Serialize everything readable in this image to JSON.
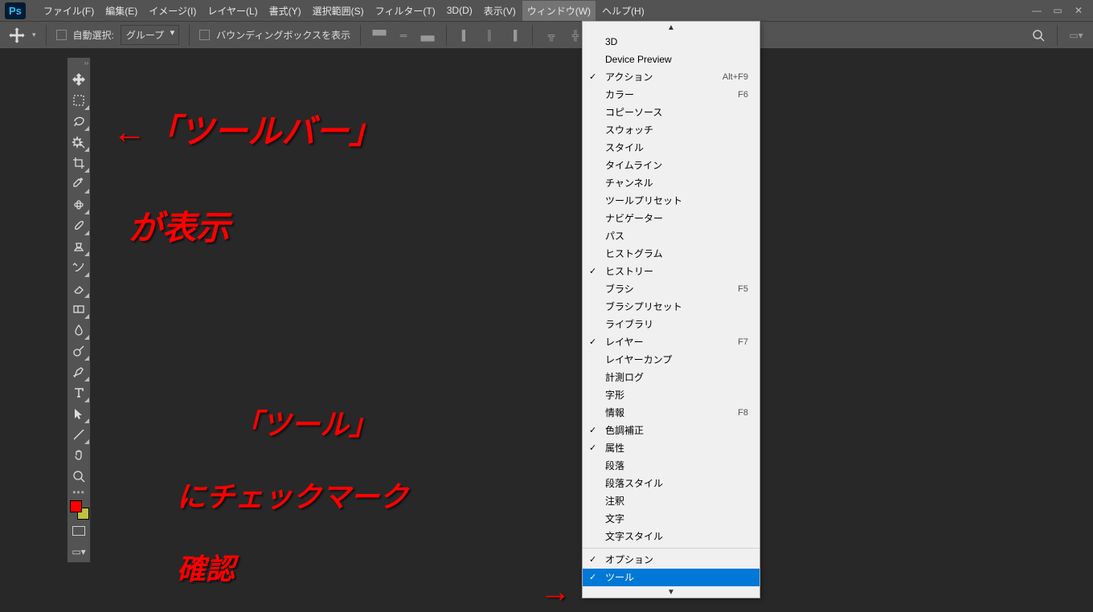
{
  "logo": "Ps",
  "menu": {
    "items": [
      "ファイル(F)",
      "編集(E)",
      "イメージ(I)",
      "レイヤー(L)",
      "書式(Y)",
      "選択範囲(S)",
      "フィルター(T)",
      "3D(D)",
      "表示(V)",
      "ウィンドウ(W)",
      "ヘルプ(H)"
    ],
    "active_index": 9
  },
  "options": {
    "autoselect_label": "自動選択:",
    "autoselect_mode": "グループ",
    "bbox_label": "バウンディングボックスを表示"
  },
  "toolbar": {
    "tools": [
      "move-tool",
      "marquee-tool",
      "lasso-tool",
      "magic-wand-tool",
      "crop-tool",
      "eyedropper-tool",
      "spot-heal-tool",
      "brush-tool",
      "clone-stamp-tool",
      "history-brush-tool",
      "eraser-tool",
      "gradient-tool",
      "blur-tool",
      "dodge-tool",
      "pen-tool",
      "type-tool",
      "path-select-tool",
      "line-tool",
      "hand-tool",
      "zoom-tool"
    ],
    "swatch_fg": "#ff0000",
    "swatch_bg": "#c0c040"
  },
  "dropdown": {
    "items": [
      {
        "label": "3D"
      },
      {
        "label": "Device Preview"
      },
      {
        "chk": true,
        "label": "アクション",
        "sc": "Alt+F9"
      },
      {
        "label": "カラー",
        "sc": "F6"
      },
      {
        "label": "コピーソース"
      },
      {
        "label": "スウォッチ"
      },
      {
        "label": "スタイル"
      },
      {
        "label": "タイムライン"
      },
      {
        "label": "チャンネル"
      },
      {
        "label": "ツールプリセット"
      },
      {
        "label": "ナビゲーター"
      },
      {
        "label": "パス"
      },
      {
        "label": "ヒストグラム"
      },
      {
        "chk": true,
        "label": "ヒストリー"
      },
      {
        "label": "ブラシ",
        "sc": "F5"
      },
      {
        "label": "ブラシプリセット"
      },
      {
        "label": "ライブラリ"
      },
      {
        "chk": true,
        "label": "レイヤー",
        "sc": "F7"
      },
      {
        "label": "レイヤーカンプ"
      },
      {
        "label": "計測ログ"
      },
      {
        "label": "字形"
      },
      {
        "label": "情報",
        "sc": "F8"
      },
      {
        "chk": true,
        "label": "色調補正"
      },
      {
        "chk": true,
        "label": "属性"
      },
      {
        "label": "段落"
      },
      {
        "label": "段落スタイル"
      },
      {
        "label": "注釈"
      },
      {
        "label": "文字"
      },
      {
        "label": "文字スタイル"
      },
      {
        "sep": true
      },
      {
        "chk": true,
        "label": "オプション"
      },
      {
        "chk": true,
        "label": "ツール",
        "sel": true
      }
    ]
  },
  "annotations": {
    "a1": "←「ツールバー」",
    "a2": "が表示",
    "a3": "「ツール」",
    "a4": "にチェックマーク",
    "a5": "確認",
    "arrow_right": "→"
  }
}
